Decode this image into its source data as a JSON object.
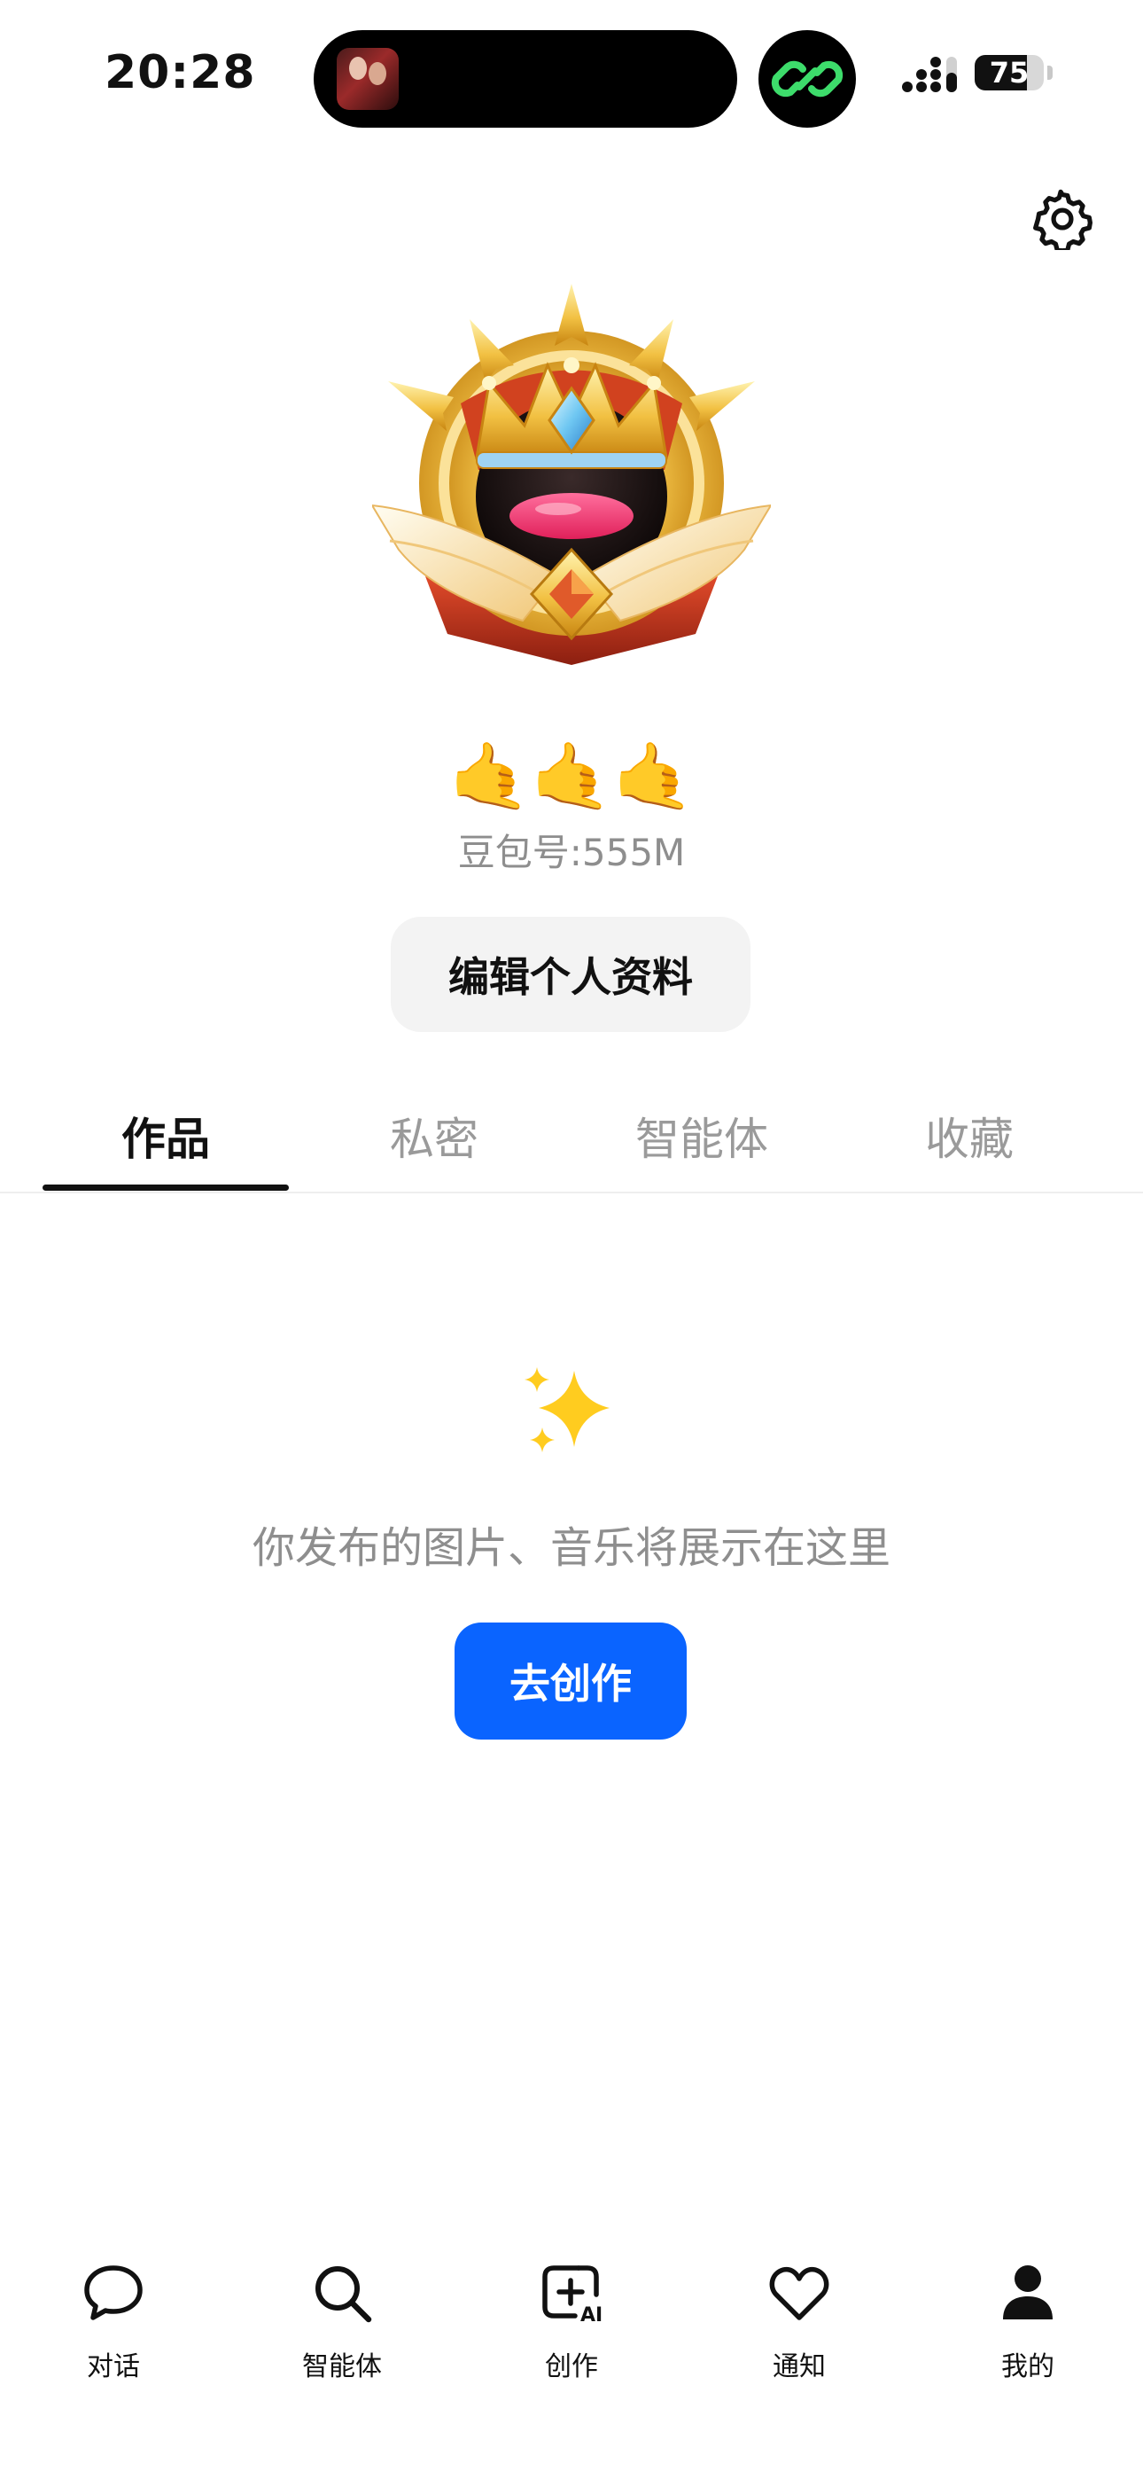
{
  "status_bar": {
    "time": "20:28",
    "battery": "75",
    "battery_level": 0.75
  },
  "profile": {
    "display_name": "🤙🤙🤙",
    "user_id": "豆包号:555M",
    "edit_label": "编辑个人资料"
  },
  "tabs": [
    {
      "label": "作品",
      "active": true
    },
    {
      "label": "私密",
      "active": false
    },
    {
      "label": "智能体",
      "active": false
    },
    {
      "label": "收藏",
      "active": false
    }
  ],
  "empty_state": {
    "message": "你发布的图片、音乐将展示在这里",
    "button_label": "去创作"
  },
  "bottom_nav": [
    {
      "label": "对话",
      "icon": "chat-bubble-icon"
    },
    {
      "label": "智能体",
      "icon": "search-icon"
    },
    {
      "label": "创作",
      "icon": "create-ai-icon"
    },
    {
      "label": "通知",
      "icon": "heart-icon"
    },
    {
      "label": "我的",
      "icon": "person-icon"
    }
  ],
  "colors": {
    "accent": "#0A64FF",
    "muted_text": "#8E8E8E",
    "edit_button_bg": "#F3F3F3",
    "link_green": "#3DDC6B"
  }
}
